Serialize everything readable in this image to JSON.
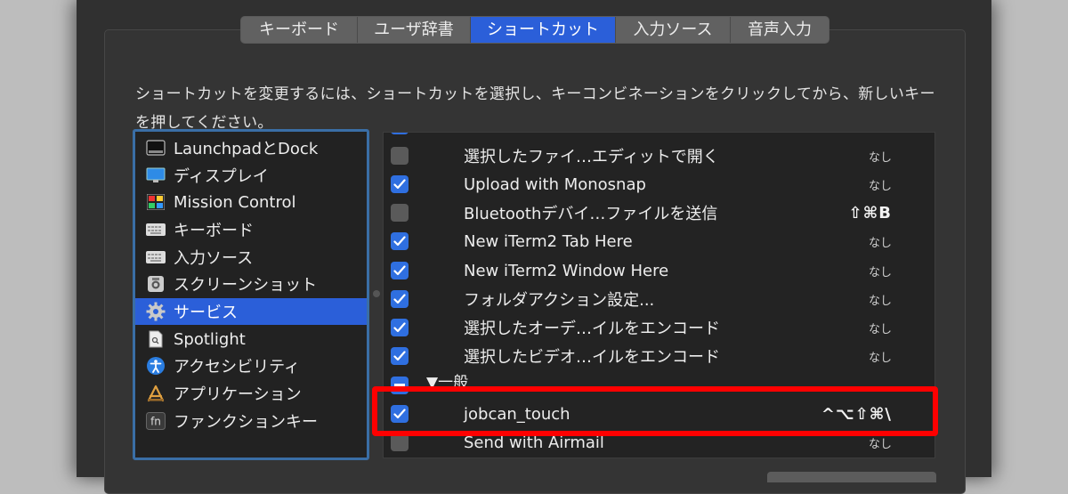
{
  "tabs": [
    {
      "label": "キーボード",
      "active": false
    },
    {
      "label": "ユーザ辞書",
      "active": false
    },
    {
      "label": "ショートカット",
      "active": true
    },
    {
      "label": "入力ソース",
      "active": false
    },
    {
      "label": "音声入力",
      "active": false
    }
  ],
  "instructions": "ショートカットを変更するには、ショートカットを選択し、キーコンビネーションをクリックしてから、新しいキーを押してください。",
  "sidebar": {
    "items": [
      {
        "label": "LaunchpadとDock",
        "icon": "launchpad-dock-icon"
      },
      {
        "label": "ディスプレイ",
        "icon": "display-icon"
      },
      {
        "label": "Mission Control",
        "icon": "mission-control-icon"
      },
      {
        "label": "キーボード",
        "icon": "keyboard-icon"
      },
      {
        "label": "入力ソース",
        "icon": "input-source-icon"
      },
      {
        "label": "スクリーンショット",
        "icon": "screenshot-icon"
      },
      {
        "label": "サービス",
        "icon": "gear-icon",
        "selected": true
      },
      {
        "label": "Spotlight",
        "icon": "spotlight-icon"
      },
      {
        "label": "アクセシビリティ",
        "icon": "accessibility-icon"
      },
      {
        "label": "アプリケーション",
        "icon": "app-store-icon"
      },
      {
        "label": "ファンクションキー",
        "icon": "fn-key-icon"
      }
    ]
  },
  "list": {
    "rows": [
      {
        "label": "選択したファイ…エディットで開く",
        "checked": false,
        "key": "なし"
      },
      {
        "label": "Upload with Monosnap",
        "checked": true,
        "key": "なし"
      },
      {
        "label": "Bluetoothデバイ…ファイルを送信",
        "checked": false,
        "key": "⇧⌘B"
      },
      {
        "label": "New iTerm2 Tab Here",
        "checked": true,
        "key": "なし"
      },
      {
        "label": "New iTerm2 Window Here",
        "checked": true,
        "key": "なし"
      },
      {
        "label": "フォルダアクション設定...",
        "checked": true,
        "key": "なし"
      },
      {
        "label": "選択したオーデ…イルをエンコード",
        "checked": true,
        "key": "なし"
      },
      {
        "label": "選択したビデオ…イルをエンコード",
        "checked": true,
        "key": "なし"
      }
    ],
    "group_label": "▼一般",
    "highlighted_row": {
      "label": "jobcan_touch",
      "checked": true,
      "key": "^⌥⇧⌘\\"
    },
    "last_row": {
      "label": "Send with Airmail",
      "checked": false,
      "key": "なし"
    }
  },
  "colors": {
    "accent": "#2b5fd9",
    "highlight": "#ff0000",
    "sidebar_border": "#3a6ea6"
  }
}
